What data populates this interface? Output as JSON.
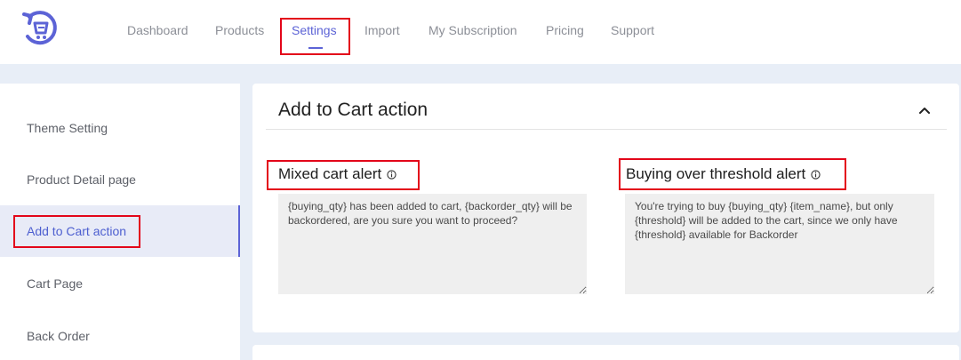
{
  "brand": {
    "logo_icon": "cart-return-logo",
    "accent": "#5c63d6"
  },
  "nav": {
    "items": [
      {
        "label": "Dashboard"
      },
      {
        "label": "Products"
      },
      {
        "label": "Settings"
      },
      {
        "label": "Import"
      },
      {
        "label": "My Subscription"
      },
      {
        "label": "Pricing"
      },
      {
        "label": "Support"
      }
    ],
    "active": "Settings"
  },
  "sidebar": {
    "items": [
      {
        "label": "Theme Setting"
      },
      {
        "label": "Product Detail page"
      },
      {
        "label": "Add to Cart action"
      },
      {
        "label": "Cart Page"
      },
      {
        "label": "Back Order"
      }
    ],
    "active": "Add to Cart action"
  },
  "section": {
    "title": "Add to Cart action",
    "collapse_icon": "chevron-up-icon",
    "mixed": {
      "label": "Mixed cart alert",
      "value": "{buying_qty} has been added to cart, {backorder_qty} will be backordered, are you sure you want to proceed?"
    },
    "threshold": {
      "label": "Buying over threshold alert",
      "value": "You're trying to buy {buying_qty} {item_name}, but only {threshold} will be added to the cart, since we only have {threshold} available for Backorder"
    }
  },
  "highlight_color": "#e3061a"
}
